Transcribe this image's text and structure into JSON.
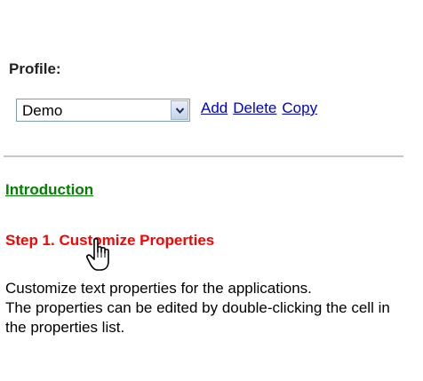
{
  "profile": {
    "label": "Profile:",
    "selected": "Demo",
    "actions": {
      "add": "Add",
      "delete": "Delete",
      "copy": "Copy"
    }
  },
  "nav": {
    "introduction": "Introduction"
  },
  "step": {
    "title": "Step 1. Customize Properties",
    "description_line1": "Customize text properties for the applications.",
    "description_line2": "The properties can be edited by double-clicking the cell in the properties list."
  },
  "colors": {
    "link": "#0000cc",
    "intro_link": "#008000",
    "step_title": "#ff0000"
  }
}
